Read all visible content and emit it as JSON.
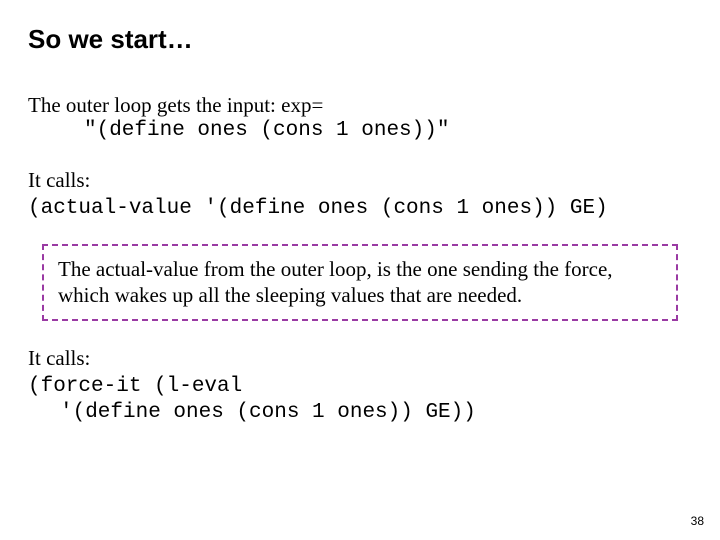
{
  "title": "So we start…",
  "p1": {
    "line1": "The outer loop gets the input:  exp=",
    "line2_code": "\"(define ones (cons 1 ones))\""
  },
  "p2": {
    "line1": "It calls:",
    "code": "(actual-value '(define ones (cons 1 ones)) GE)"
  },
  "callout": "The actual-value from the outer loop, is the one sending the force, which wakes up all the sleeping values that are needed.",
  "p3": {
    "line1": "It calls:",
    "code_l1": "(force-it (l-eval",
    "code_l2": "'(define ones (cons 1 ones)) GE))"
  },
  "page_number": "38"
}
